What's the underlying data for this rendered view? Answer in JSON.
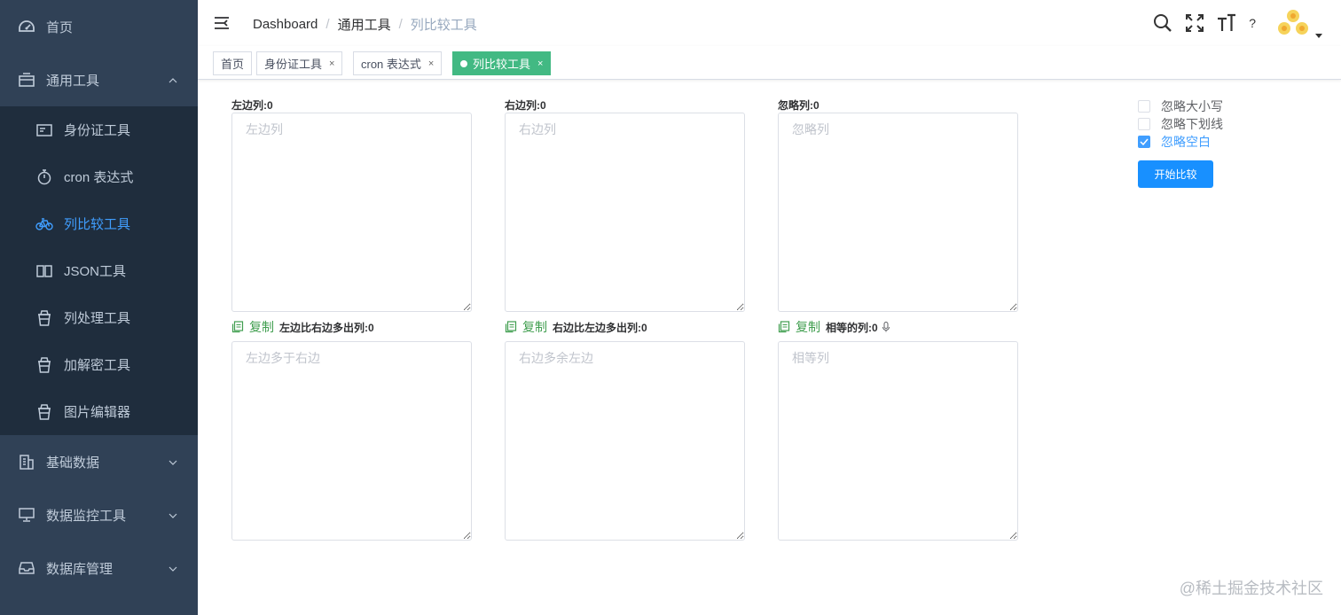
{
  "sidebar": {
    "items": [
      {
        "label": "首页",
        "icon": "dashboard-icon"
      },
      {
        "label": "通用工具",
        "icon": "toolbox-icon",
        "expanded": true,
        "children": [
          {
            "label": "身份证工具",
            "icon": "id-card-icon"
          },
          {
            "label": "cron 表达式",
            "icon": "stopwatch-icon"
          },
          {
            "label": "列比较工具",
            "icon": "bicycle-icon",
            "active": true
          },
          {
            "label": "JSON工具",
            "icon": "book-icon"
          },
          {
            "label": "列处理工具",
            "icon": "cup-icon"
          },
          {
            "label": "加解密工具",
            "icon": "cup-icon"
          },
          {
            "label": "图片编辑器",
            "icon": "cup-icon"
          }
        ]
      },
      {
        "label": "基础数据",
        "icon": "building-icon"
      },
      {
        "label": "数据监控工具",
        "icon": "monitor-icon"
      },
      {
        "label": "数据库管理",
        "icon": "database-icon"
      }
    ]
  },
  "navbar": {
    "breadcrumb": [
      "Dashboard",
      "通用工具",
      "列比较工具"
    ],
    "help_label": "?"
  },
  "tags": [
    {
      "label": "首页",
      "closable": false
    },
    {
      "label": "身份证工具",
      "closable": true
    },
    {
      "label": "cron 表达式",
      "closable": true
    },
    {
      "label": "列比较工具",
      "closable": true,
      "active": true
    }
  ],
  "tag_close_glyph": "×",
  "columns": {
    "left": {
      "label": "左边列:0",
      "placeholder": "左边列"
    },
    "right": {
      "label": "右边列:0",
      "placeholder": "右边列"
    },
    "ignore": {
      "label": "忽略列:0",
      "placeholder": "忽略列"
    }
  },
  "results": {
    "copy_label": "复制",
    "left_extra": {
      "label": "左边比右边多出列:0",
      "placeholder": "左边多于右边"
    },
    "right_extra": {
      "label": "右边比左边多出列:0",
      "placeholder": "右边多余左边"
    },
    "equal": {
      "label": "相等的列:0",
      "placeholder": "相等列"
    }
  },
  "options": {
    "ignore_case": {
      "label": "忽略大小写",
      "checked": false
    },
    "ignore_underscore": {
      "label": "忽略下划线",
      "checked": false
    },
    "ignore_blank": {
      "label": "忽略空白",
      "checked": true
    }
  },
  "compare_button": "开始比较",
  "watermark": "@稀土掘金技术社区",
  "colors": {
    "sidebar_bg": "#304156",
    "submenu_bg": "#1f2d3d",
    "active_menu": "#409eff",
    "active_tag": "#42b983",
    "primary_button": "#1890ff",
    "copy_green": "#409e4f"
  }
}
